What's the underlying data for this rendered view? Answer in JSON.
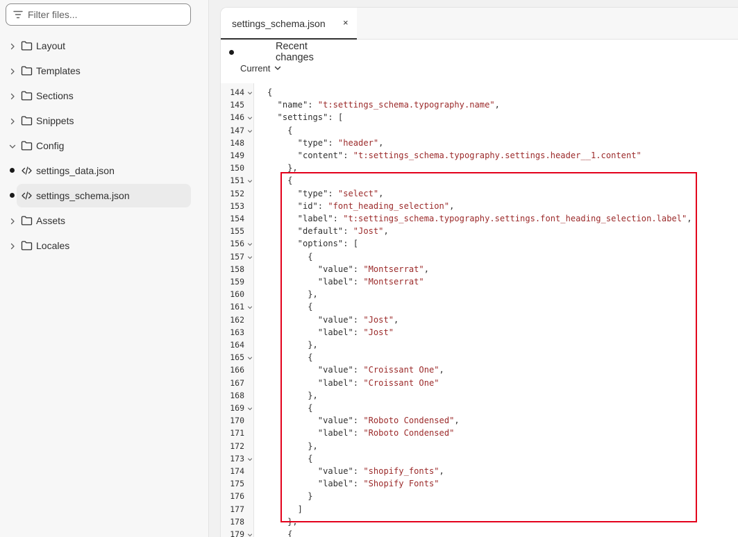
{
  "sidebar": {
    "filter_placeholder": "Filter files...",
    "items": [
      {
        "label": "Layout",
        "kind": "folder",
        "expanded": false
      },
      {
        "label": "Templates",
        "kind": "folder",
        "expanded": false
      },
      {
        "label": "Sections",
        "kind": "folder",
        "expanded": false
      },
      {
        "label": "Snippets",
        "kind": "folder",
        "expanded": false
      },
      {
        "label": "Config",
        "kind": "folder",
        "expanded": true
      },
      {
        "label": "settings_data.json",
        "kind": "file",
        "modified": true
      },
      {
        "label": "settings_schema.json",
        "kind": "file",
        "modified": true,
        "selected": true
      },
      {
        "label": "Assets",
        "kind": "folder",
        "expanded": false
      },
      {
        "label": "Locales",
        "kind": "folder",
        "expanded": false
      }
    ]
  },
  "editor": {
    "tab_label": "settings_schema.json",
    "tab_close": "×",
    "recent_changes": "Recent changes",
    "version": "Current",
    "highlight_color": "#e3001b",
    "lines": [
      {
        "n": "144",
        "fold": true,
        "indent": 0,
        "t": "{"
      },
      {
        "n": "145",
        "fold": false,
        "indent": 2,
        "k": "\"name\"",
        "p": ": ",
        "s": "\"t:settings_schema.typography.name\"",
        "e": ","
      },
      {
        "n": "146",
        "fold": true,
        "indent": 2,
        "k": "\"settings\"",
        "p": ": [",
        "s": "",
        "e": ""
      },
      {
        "n": "147",
        "fold": true,
        "indent": 4,
        "t": "{"
      },
      {
        "n": "148",
        "fold": false,
        "indent": 6,
        "k": "\"type\"",
        "p": ": ",
        "s": "\"header\"",
        "e": ","
      },
      {
        "n": "149",
        "fold": false,
        "indent": 6,
        "k": "\"content\"",
        "p": ": ",
        "s": "\"t:settings_schema.typography.settings.header__1.content\"",
        "e": ""
      },
      {
        "n": "150",
        "fold": false,
        "indent": 4,
        "t": "},"
      },
      {
        "n": "151",
        "fold": true,
        "indent": 4,
        "t": "{"
      },
      {
        "n": "152",
        "fold": false,
        "indent": 6,
        "k": "\"type\"",
        "p": ": ",
        "s": "\"select\"",
        "e": ","
      },
      {
        "n": "153",
        "fold": false,
        "indent": 6,
        "k": "\"id\"",
        "p": ": ",
        "s": "\"font_heading_selection\"",
        "e": ","
      },
      {
        "n": "154",
        "fold": false,
        "indent": 6,
        "k": "\"label\"",
        "p": ": ",
        "s": "\"t:settings_schema.typography.settings.font_heading_selection.label\"",
        "e": ","
      },
      {
        "n": "155",
        "fold": false,
        "indent": 6,
        "k": "\"default\"",
        "p": ": ",
        "s": "\"Jost\"",
        "e": ","
      },
      {
        "n": "156",
        "fold": true,
        "indent": 6,
        "k": "\"options\"",
        "p": ": [",
        "s": "",
        "e": ""
      },
      {
        "n": "157",
        "fold": true,
        "indent": 8,
        "t": "{"
      },
      {
        "n": "158",
        "fold": false,
        "indent": 10,
        "k": "\"value\"",
        "p": ": ",
        "s": "\"Montserrat\"",
        "e": ","
      },
      {
        "n": "159",
        "fold": false,
        "indent": 10,
        "k": "\"label\"",
        "p": ": ",
        "s": "\"Montserrat\"",
        "e": ""
      },
      {
        "n": "160",
        "fold": false,
        "indent": 8,
        "t": "},"
      },
      {
        "n": "161",
        "fold": true,
        "indent": 8,
        "t": "{"
      },
      {
        "n": "162",
        "fold": false,
        "indent": 10,
        "k": "\"value\"",
        "p": ": ",
        "s": "\"Jost\"",
        "e": ","
      },
      {
        "n": "163",
        "fold": false,
        "indent": 10,
        "k": "\"label\"",
        "p": ": ",
        "s": "\"Jost\"",
        "e": ""
      },
      {
        "n": "164",
        "fold": false,
        "indent": 8,
        "t": "},"
      },
      {
        "n": "165",
        "fold": true,
        "indent": 8,
        "t": "{"
      },
      {
        "n": "166",
        "fold": false,
        "indent": 10,
        "k": "\"value\"",
        "p": ": ",
        "s": "\"Croissant One\"",
        "e": ","
      },
      {
        "n": "167",
        "fold": false,
        "indent": 10,
        "k": "\"label\"",
        "p": ": ",
        "s": "\"Croissant One\"",
        "e": ""
      },
      {
        "n": "168",
        "fold": false,
        "indent": 8,
        "t": "},"
      },
      {
        "n": "169",
        "fold": true,
        "indent": 8,
        "t": "{"
      },
      {
        "n": "170",
        "fold": false,
        "indent": 10,
        "k": "\"value\"",
        "p": ": ",
        "s": "\"Roboto Condensed\"",
        "e": ","
      },
      {
        "n": "171",
        "fold": false,
        "indent": 10,
        "k": "\"label\"",
        "p": ": ",
        "s": "\"Roboto Condensed\"",
        "e": ""
      },
      {
        "n": "172",
        "fold": false,
        "indent": 8,
        "t": "},"
      },
      {
        "n": "173",
        "fold": true,
        "indent": 8,
        "t": "{"
      },
      {
        "n": "174",
        "fold": false,
        "indent": 10,
        "k": "\"value\"",
        "p": ": ",
        "s": "\"shopify_fonts\"",
        "e": ","
      },
      {
        "n": "175",
        "fold": false,
        "indent": 10,
        "k": "\"label\"",
        "p": ": ",
        "s": "\"Shopify Fonts\"",
        "e": ""
      },
      {
        "n": "176",
        "fold": false,
        "indent": 8,
        "t": "}"
      },
      {
        "n": "177",
        "fold": false,
        "indent": 6,
        "t": "]"
      },
      {
        "n": "178",
        "fold": false,
        "indent": 4,
        "t": "},"
      },
      {
        "n": "179",
        "fold": true,
        "indent": 4,
        "t": "{"
      }
    ]
  }
}
